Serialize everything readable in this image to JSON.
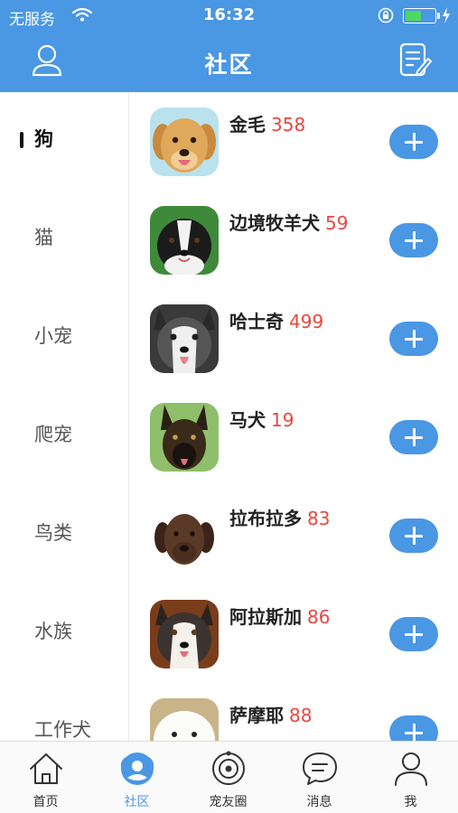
{
  "status_bar": {
    "carrier": "无服务",
    "time": "16:32",
    "battery_level": 0.55
  },
  "nav": {
    "title": "社区",
    "left_icon": "user-icon",
    "right_icon": "edit-note-icon"
  },
  "colors": {
    "primary": "#4a97e4",
    "count": "#e8473f",
    "battery": "#4cd964"
  },
  "categories": [
    {
      "label": "狗",
      "active": true
    },
    {
      "label": "猫",
      "active": false
    },
    {
      "label": "小宠",
      "active": false
    },
    {
      "label": "爬宠",
      "active": false
    },
    {
      "label": "鸟类",
      "active": false
    },
    {
      "label": "水族",
      "active": false
    },
    {
      "label": "工作犬",
      "active": false
    }
  ],
  "breeds": [
    {
      "name": "金毛",
      "count": "358",
      "icon": "golden-retriever-photo"
    },
    {
      "name": "边境牧羊犬",
      "count": "59",
      "icon": "border-collie-photo"
    },
    {
      "name": "哈士奇",
      "count": "499",
      "icon": "husky-photo"
    },
    {
      "name": "马犬",
      "count": "19",
      "icon": "malinois-photo"
    },
    {
      "name": "拉布拉多",
      "count": "83",
      "icon": "labrador-photo"
    },
    {
      "name": "阿拉斯加",
      "count": "86",
      "icon": "alaskan-malamute-photo"
    },
    {
      "name": "萨摩耶",
      "count": "88",
      "icon": "samoyed-photo"
    }
  ],
  "tabs": [
    {
      "label": "首页",
      "icon": "home-icon",
      "active": false
    },
    {
      "label": "社区",
      "icon": "community-icon",
      "active": true
    },
    {
      "label": "宠友圈",
      "icon": "pet-circle-icon",
      "active": false
    },
    {
      "label": "消息",
      "icon": "message-icon",
      "active": false
    },
    {
      "label": "我",
      "icon": "profile-icon",
      "active": false
    }
  ]
}
